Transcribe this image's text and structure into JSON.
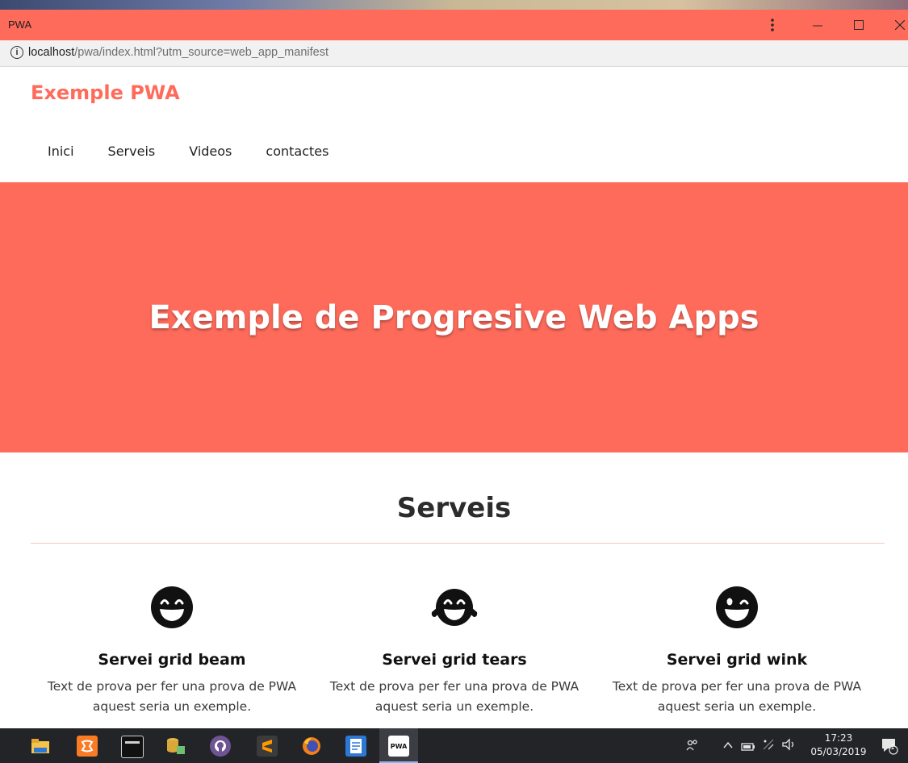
{
  "window": {
    "title": "PWA",
    "menu_icon": "kebab-menu-icon",
    "minimize_icon": "minimize-icon",
    "maximize_icon": "maximize-icon",
    "close_icon": "close-icon"
  },
  "address": {
    "host": "localhost",
    "path": "/pwa/index.html?utm_source=web_app_manifest",
    "info_icon": "info-icon"
  },
  "site": {
    "brand": "Exemple PWA",
    "nav": [
      "Inici",
      "Serveis",
      "Videos",
      "contactes"
    ],
    "hero_title": "Exemple de Progresive Web Apps",
    "section_title": "Serveis",
    "services": [
      {
        "icon": "grin-beam-icon",
        "title": "Servei grid beam",
        "text": "Text de prova per fer una prova de PWA aquest seria un exemple."
      },
      {
        "icon": "grin-tears-icon",
        "title": "Servei grid tears",
        "text": "Text de prova per fer una prova de PWA aquest seria un exemple."
      },
      {
        "icon": "grin-wink-icon",
        "title": "Servei grid wink",
        "text": "Text de prova per fer una prova de PWA aquest seria un exemple."
      }
    ]
  },
  "taskbar": {
    "apps": [
      "file-explorer-icon",
      "xampp-icon",
      "terminal-icon",
      "database-tool-icon",
      "github-icon",
      "sublime-text-icon",
      "firefox-icon",
      "notepad-icon",
      "pwa-app-icon"
    ],
    "active_app_label": "PWA",
    "time": "17:23",
    "date": "05/03/2019",
    "notification_count": "1"
  },
  "colors": {
    "accent": "#ff6b5b",
    "taskbar": "#232428"
  }
}
